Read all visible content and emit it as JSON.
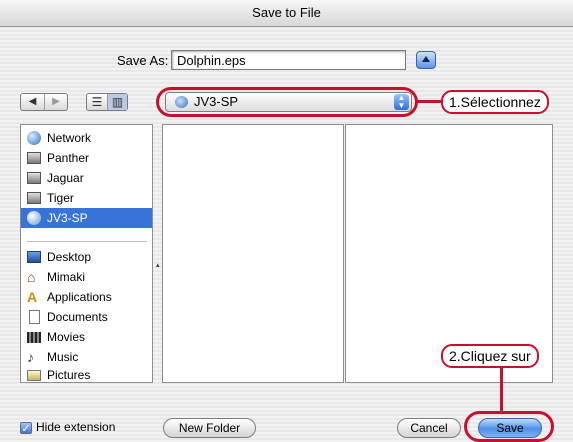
{
  "dialog": {
    "title": "Save to File"
  },
  "save_as": {
    "label": "Save As:",
    "value": "Dolphin.eps"
  },
  "nav": {
    "back": "◀",
    "forward": "▶",
    "list_view": "☰",
    "column_view": "▥"
  },
  "location": {
    "value": "JV3-SP",
    "arrows": "▲▼"
  },
  "sidebar": {
    "devices": [
      {
        "label": "Network",
        "icon": "network-globe-icon"
      },
      {
        "label": "Panther",
        "icon": "hard-drive-icon"
      },
      {
        "label": "Jaguar",
        "icon": "hard-drive-icon"
      },
      {
        "label": "Tiger",
        "icon": "hard-drive-icon"
      },
      {
        "label": "JV3-SP",
        "icon": "network-volume-icon",
        "selected": true
      }
    ],
    "places": [
      {
        "label": "Desktop",
        "icon": "desktop-icon"
      },
      {
        "label": "Mimaki",
        "icon": "home-icon"
      },
      {
        "label": "Applications",
        "icon": "applications-icon"
      },
      {
        "label": "Documents",
        "icon": "documents-icon"
      },
      {
        "label": "Movies",
        "icon": "movies-icon"
      },
      {
        "label": "Music",
        "icon": "music-icon"
      },
      {
        "label": "Pictures",
        "icon": "pictures-icon"
      }
    ]
  },
  "footer": {
    "hide_extension": "Hide extension",
    "new_folder": "New Folder",
    "cancel": "Cancel",
    "save": "Save"
  },
  "annotations": {
    "step1": "1.Sélectionnez",
    "step2": "2.Cliquez sur"
  },
  "colors": {
    "selection": "#3874d8",
    "annotation": "#c8102e"
  }
}
